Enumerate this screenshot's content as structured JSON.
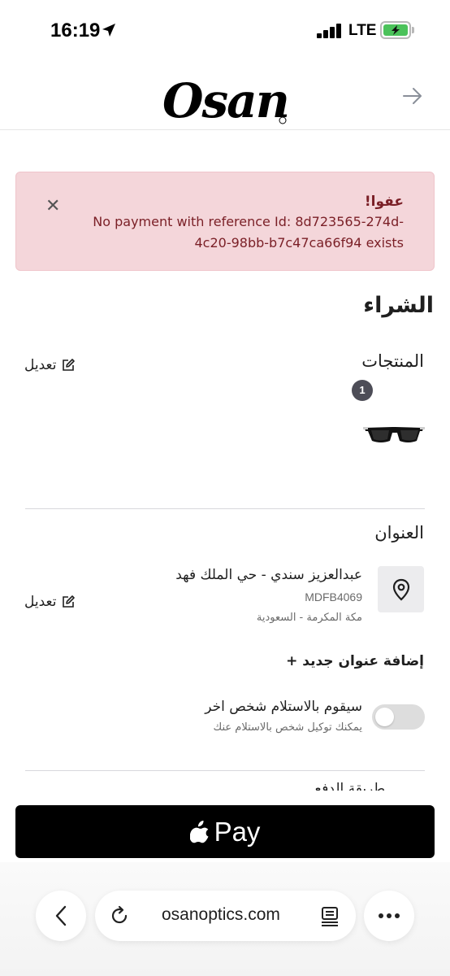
{
  "status_bar": {
    "time": "16:19",
    "network": "LTE",
    "icons": [
      "location-arrow-icon",
      "signal-icon",
      "battery-charging-icon"
    ]
  },
  "header": {
    "logo_text": "Osan",
    "forward_icon": "arrow-right-icon"
  },
  "alert": {
    "title": "عفوا!",
    "message": "No payment with reference Id: 8d723565-274d-4c20-98bb-b7c47ca66f94 exists",
    "close_icon": "close-icon",
    "colors": {
      "background": "#f4d6da",
      "text": "#7a1f26"
    }
  },
  "checkout": {
    "title": "الشراء",
    "products": {
      "title": "المنتجات",
      "edit_label": "تعديل",
      "count_badge": "1",
      "items": [
        {
          "icon": "sunglasses-image"
        }
      ]
    },
    "address": {
      "title": "العنوان",
      "edit_label": "تعديل",
      "name": "عبدالعزيز سندي - حي الملك فهد",
      "code": "MDFB4069",
      "city": "مكة المكرمة - السعودية",
      "icon": "map-pin-icon"
    },
    "add_address_label": "إضافة عنوان جديد +",
    "delegate": {
      "label": "سيقوم بالاستلام شخص اخر",
      "sub": "يمكنك توكيل شخص بالاستلام عنك",
      "enabled": false
    },
    "next_section_partial": "طريقة الدفع"
  },
  "apple_pay": {
    "label": "Pay",
    "icon": "apple-logo-icon",
    "colors": {
      "background": "#000000",
      "text": "#ffffff"
    }
  },
  "browser": {
    "url": "osanoptics.com",
    "icons": [
      "chevron-left-icon",
      "reload-icon",
      "reader-icon",
      "more-icon"
    ]
  }
}
